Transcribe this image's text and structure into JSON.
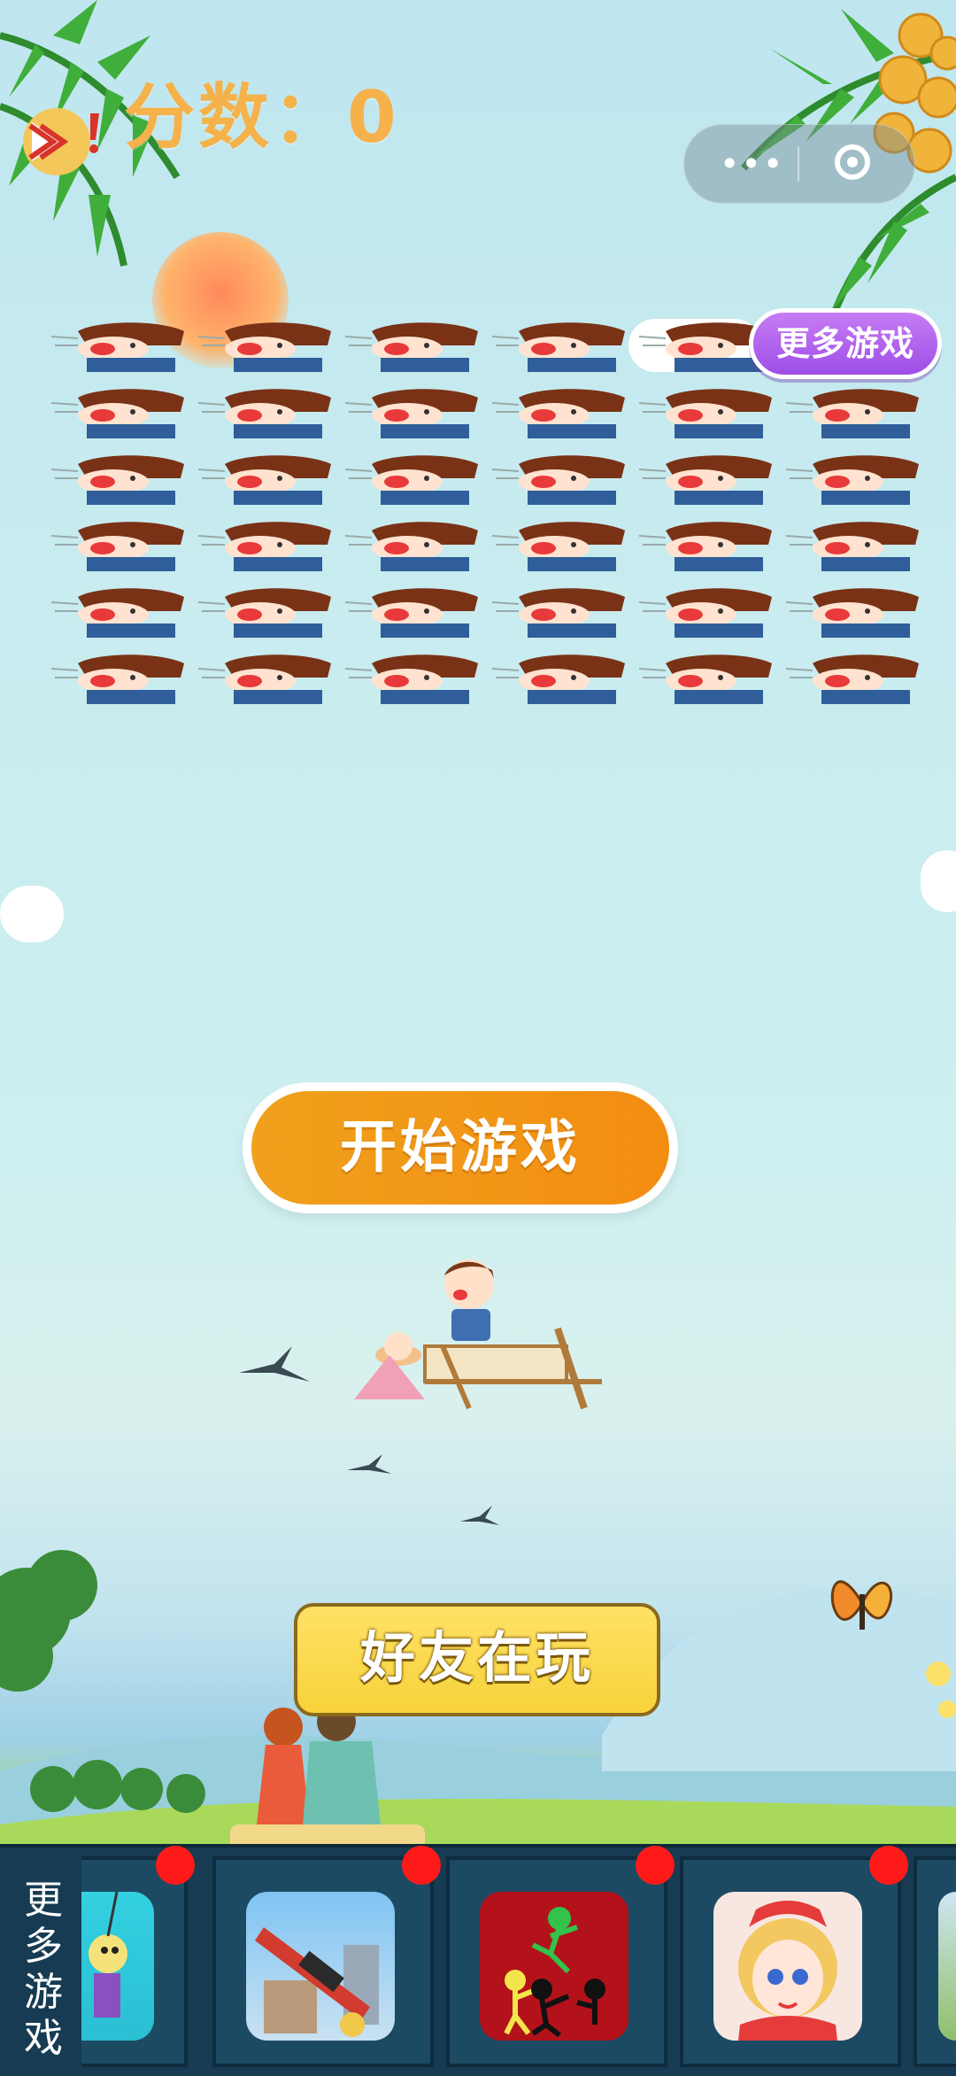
{
  "score": {
    "label": "分数：",
    "value": "0"
  },
  "capsule": {
    "menu_dots": "•••"
  },
  "more_games_pill": "更多游戏",
  "target_grid": {
    "rows": 6,
    "cols": 6
  },
  "start_button": "开始游戏",
  "friends_button": "好友在玩",
  "bottom_bar": {
    "label": "更多游戏",
    "games": [
      {
        "name": "rope-rescue-game",
        "colors": [
          "#33d0e0",
          "#f6e27a"
        ]
      },
      {
        "name": "gun-shooter-game",
        "colors": [
          "#7fc3f2",
          "#d23b2f"
        ]
      },
      {
        "name": "stickman-fight-game",
        "colors": [
          "#b3121a",
          "#33c24a"
        ]
      },
      {
        "name": "princess-dressup-game",
        "colors": [
          "#f7e7e0",
          "#e53b3b"
        ]
      }
    ]
  }
}
